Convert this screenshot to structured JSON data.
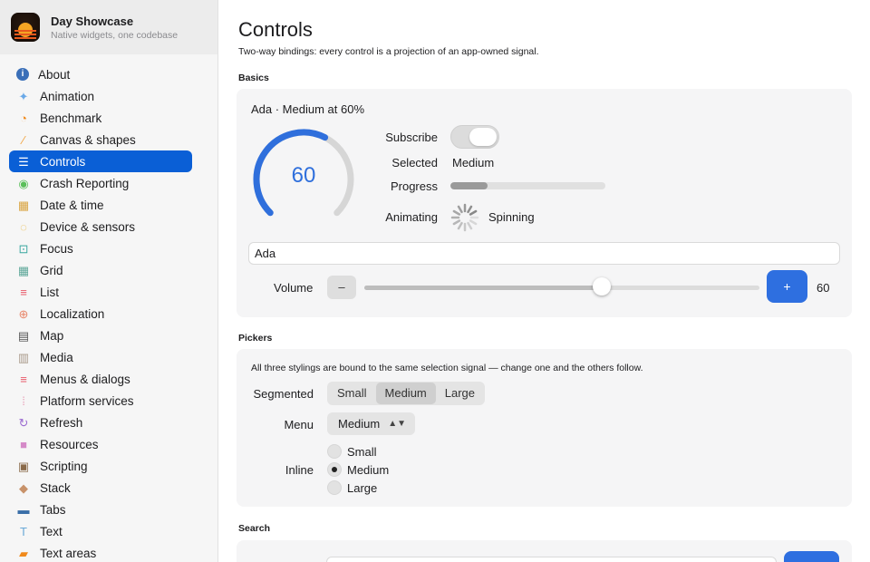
{
  "app": {
    "title": "Day Showcase",
    "subtitle": "Native widgets, one codebase"
  },
  "sidebar": {
    "active_color": "#0a5fd6",
    "items": [
      {
        "label": "About",
        "icon": "info-icon",
        "color": "#3a6fb8"
      },
      {
        "label": "Animation",
        "icon": "sparkles-icon",
        "color": "#6aa9e8"
      },
      {
        "label": "Benchmark",
        "icon": "speedometer-icon",
        "color": "#f08a1c"
      },
      {
        "label": "Canvas & shapes",
        "icon": "brush-icon",
        "color": "#f0a23c"
      },
      {
        "label": "Controls",
        "icon": "sliders-icon",
        "color": "#ffffff"
      },
      {
        "label": "Crash Reporting",
        "icon": "broadcast-icon",
        "color": "#5bbf5b"
      },
      {
        "label": "Date & time",
        "icon": "calendar-icon",
        "color": "#d9a441"
      },
      {
        "label": "Device & sensors",
        "icon": "sensor-icon",
        "color": "#e8b63c"
      },
      {
        "label": "Focus",
        "icon": "focus-icon",
        "color": "#3aa7a0"
      },
      {
        "label": "Grid",
        "icon": "grid-icon",
        "color": "#5fa89a"
      },
      {
        "label": "List",
        "icon": "list-icon",
        "color": "#e85a6a"
      },
      {
        "label": "Localization",
        "icon": "globe-icon",
        "color": "#e8866a"
      },
      {
        "label": "Map",
        "icon": "map-icon",
        "color": "#555555"
      },
      {
        "label": "Media",
        "icon": "film-icon",
        "color": "#a99a8a"
      },
      {
        "label": "Menus & dialogs",
        "icon": "menu-icon",
        "color": "#e85a6a"
      },
      {
        "label": "Platform services",
        "icon": "dots-grid-icon",
        "color": "#e8a0b8"
      },
      {
        "label": "Refresh",
        "icon": "refresh-icon",
        "color": "#9a6ad0"
      },
      {
        "label": "Resources",
        "icon": "folder-icon",
        "color": "#d58ac8"
      },
      {
        "label": "Scripting",
        "icon": "terminal-icon",
        "color": "#8a6a4a"
      },
      {
        "label": "Stack",
        "icon": "stack-icon",
        "color": "#c8926a"
      },
      {
        "label": "Tabs",
        "icon": "tabs-icon",
        "color": "#3a6fa8"
      },
      {
        "label": "Text",
        "icon": "text-icon",
        "color": "#6aa9d8"
      },
      {
        "label": "Text areas",
        "icon": "document-edit-icon",
        "color": "#f08a1c"
      }
    ]
  },
  "page": {
    "title": "Controls",
    "description": "Two-way bindings: every control is a projection of an app-owned signal."
  },
  "basics": {
    "section_label": "Basics",
    "title": "Ada · Medium at 60%",
    "gauge": {
      "value": "60",
      "fraction": 0.6
    },
    "subscribe_label": "Subscribe",
    "subscribe_on": true,
    "selected_label": "Selected",
    "selected_value": "Medium",
    "progress_label": "Progress",
    "progress_fraction": 0.24,
    "animating_label": "Animating",
    "animating_value": "Spinning",
    "name_value": "Ada",
    "volume_label": "Volume",
    "minus_label": "–",
    "plus_label": "+",
    "volume_value": "60",
    "volume_fraction": 0.6,
    "accent": "#2e6fe0"
  },
  "pickers": {
    "section_label": "Pickers",
    "description": "All three stylings are bound to the same selection signal — change one and the others follow.",
    "segmented_label": "Segmented",
    "segments": [
      "Small",
      "Medium",
      "Large"
    ],
    "selected_segment": 1,
    "menu_label": "Menu",
    "menu_value": "Medium",
    "inline_label": "Inline",
    "radio_options": [
      "Small",
      "Medium",
      "Large"
    ],
    "selected_radio": 1
  },
  "search": {
    "section_label": "Search"
  }
}
